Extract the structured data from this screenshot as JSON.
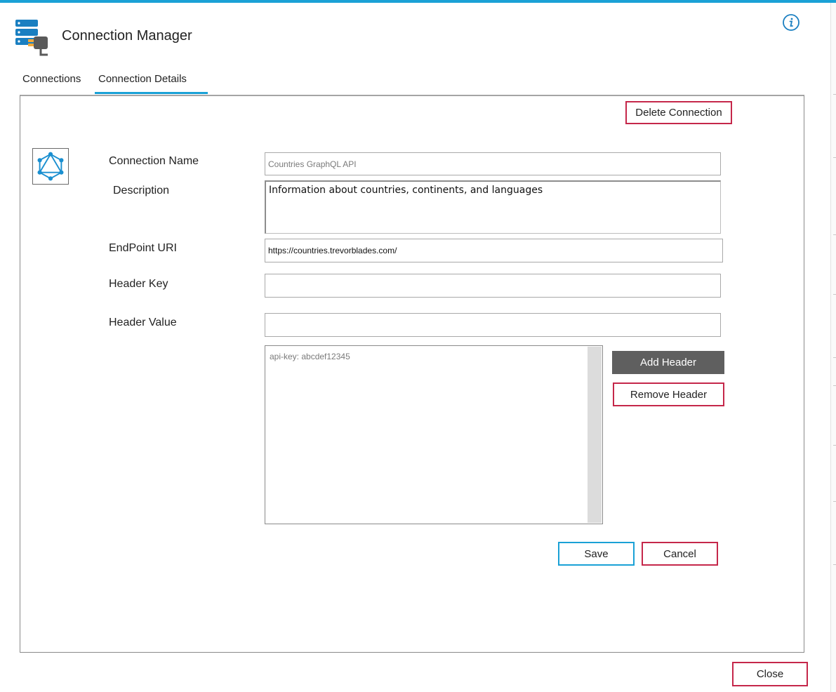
{
  "app": {
    "title": "Connection Manager",
    "icon": "server-plug-icon",
    "info_icon": "info-icon",
    "accent_color": "#1aa1d6",
    "danger_border_color": "#c5274a"
  },
  "tabs": [
    {
      "label": "Connections",
      "active": false
    },
    {
      "label": "Connection Details",
      "active": true
    }
  ],
  "details": {
    "delete_button": "Delete Connection",
    "connection_icon": "graphql-icon",
    "fields": {
      "name": {
        "label": "Connection Name",
        "value": "Countries GraphQL API"
      },
      "description": {
        "label": "Description",
        "value": "Information about countries, continents, and languages"
      },
      "endpoint": {
        "label": "EndPoint URI",
        "value": "https://countries.trevorblades.com/"
      },
      "header_key": {
        "label": "Header Key",
        "value": ""
      },
      "header_value": {
        "label": "Header Value",
        "value": ""
      }
    },
    "headers": [
      "api-key: abcdef12345"
    ],
    "add_header_button": "Add Header",
    "remove_header_button": "Remove Header",
    "save_button": "Save",
    "cancel_button": "Cancel"
  },
  "footer": {
    "close_button": "Close"
  }
}
